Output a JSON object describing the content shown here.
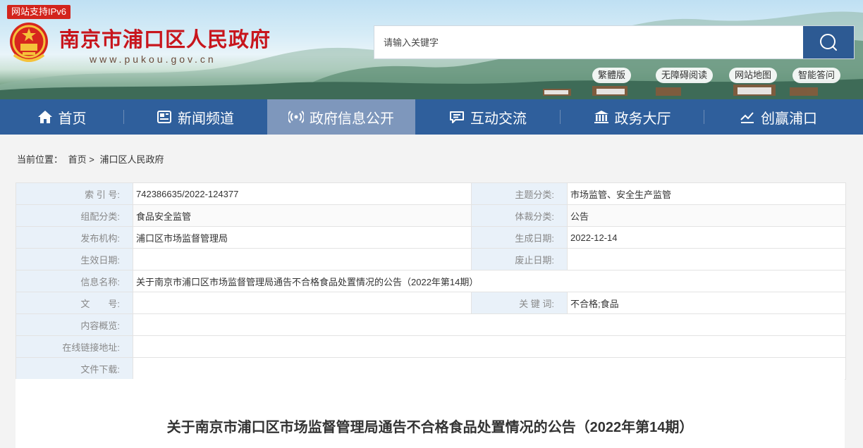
{
  "header": {
    "ipv6_badge": "网站支持IPv6",
    "site_title": "南京市浦口区人民政府",
    "site_url": "www.pukou.gov.cn",
    "search": {
      "placeholder": "请输入关键字",
      "value": ""
    },
    "quick_links": [
      "繁體版",
      "无障碍阅读",
      "网站地图",
      "智能答问"
    ]
  },
  "nav": {
    "items": [
      {
        "label": "首页",
        "icon": "home-icon"
      },
      {
        "label": "新闻频道",
        "icon": "newspaper-icon"
      },
      {
        "label": "政府信息公开",
        "icon": "broadcast-icon",
        "active": true
      },
      {
        "label": "互动交流",
        "icon": "chat-icon"
      },
      {
        "label": "政务大厅",
        "icon": "bank-icon"
      },
      {
        "label": "创赢浦口",
        "icon": "chart-icon"
      }
    ]
  },
  "breadcrumb": {
    "prefix": "当前位置：",
    "items": [
      "首页",
      "浦口区人民政府"
    ],
    "separator": ">"
  },
  "meta": {
    "index_no": {
      "label": "索 引 号:",
      "value": "742386635/2022-124377"
    },
    "topic": {
      "label": "主题分类:",
      "value": "市场监管、安全生产监管"
    },
    "org_category": {
      "label": "组配分类:",
      "value": "食品安全监管"
    },
    "genre": {
      "label": "体裁分类:",
      "value": "公告"
    },
    "publisher": {
      "label": "发布机构:",
      "value": "浦口区市场监督管理局"
    },
    "created": {
      "label": "生成日期:",
      "value": "2022-12-14"
    },
    "effective": {
      "label": "生效日期:",
      "value": ""
    },
    "expired": {
      "label": "废止日期:",
      "value": ""
    },
    "info_name": {
      "label": "信息名称:",
      "value": "关于南京市浦口区市场监督管理局通告不合格食品处置情况的公告（2022年第14期）"
    },
    "doc_no": {
      "label": "文　　号:",
      "value": ""
    },
    "keywords": {
      "label": "关 键 词:",
      "value": "不合格;食品"
    },
    "summary": {
      "label": "内容概览:",
      "value": ""
    },
    "link": {
      "label": "在线链接地址:",
      "value": ""
    },
    "download": {
      "label": "文件下载:",
      "value": ""
    }
  },
  "article": {
    "title": "关于南京市浦口区市场监督管理局通告不合格食品处置情况的公告（2022年第14期）"
  },
  "colors": {
    "nav_bg": "#2f5f9c",
    "nav_active": "#7e97bc",
    "title_red": "#c8161d",
    "search_btn": "#2d5a93"
  }
}
